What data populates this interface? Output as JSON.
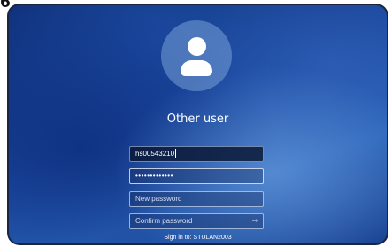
{
  "corner_label": "6",
  "login": {
    "user_name": "Other user",
    "username_value": "hs00543210",
    "password_mask": "•••••••••••••",
    "new_password_placeholder": "New password",
    "confirm_password_placeholder": "Confirm password",
    "submit_arrow": "→",
    "sign_in_to": "Sign in to: STULAN2003"
  },
  "icons": {
    "avatar": "user-avatar-icon",
    "submit": "arrow-right-icon"
  },
  "colors": {
    "background": "#1c4aa0",
    "text": "#ffffff"
  }
}
